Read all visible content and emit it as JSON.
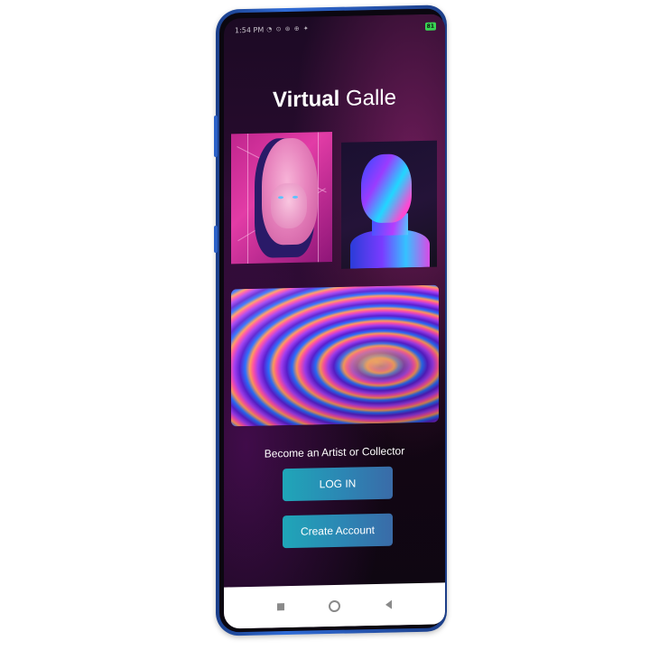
{
  "status_bar": {
    "time": "1:54 PM",
    "left_icons": "◔ ⊙ ⊛ ⊕ ✦",
    "battery": "81"
  },
  "app": {
    "title_bold": "Virtual",
    "title_light": "Galle"
  },
  "artworks": [
    {
      "name": "pink-bearded-bust"
    },
    {
      "name": "holographic-david-bust"
    },
    {
      "name": "neon-swirl"
    }
  ],
  "tagline": "Become an Artist or Collector",
  "buttons": {
    "login": "LOG IN",
    "create_account": "Create Account"
  },
  "colors": {
    "button_start": "#1fa6b8",
    "button_end": "#3a6ba8",
    "phone_frame": "#2f6bd6",
    "background": "#1c0a24"
  },
  "nav_icons": [
    "recents-square-icon",
    "home-circle-icon",
    "back-triangle-icon"
  ]
}
